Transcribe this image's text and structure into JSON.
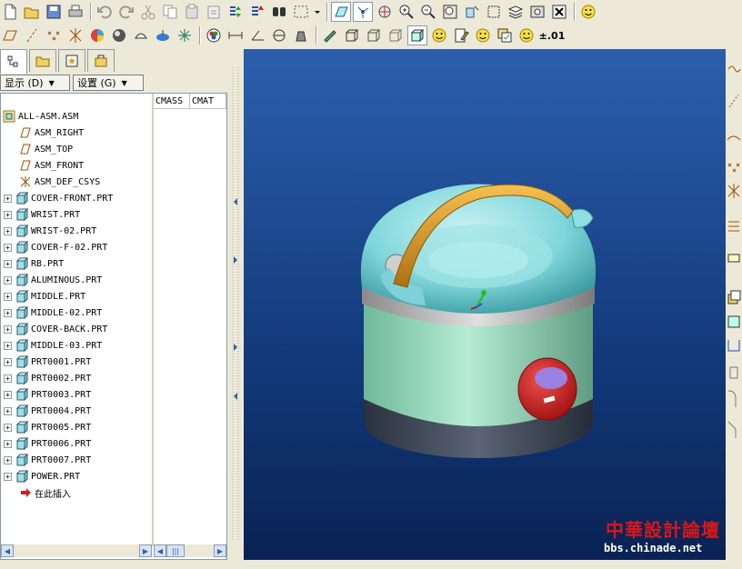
{
  "toolbar_top": {
    "icons": [
      "new-icon",
      "open-icon",
      "save-icon",
      "print-icon",
      "undo-icon",
      "redo-icon",
      "cut-icon",
      "copy-icon",
      "paste-icon",
      "paste-special-icon",
      "regenerate-icon",
      "regenerate-manager-icon",
      "find-icon",
      "select-box-icon",
      "dropdown-icon",
      "datum-display-icon",
      "datum-point-display-icon",
      "spin-center-icon",
      "zoom-in-icon",
      "zoom-out-icon",
      "refit-icon",
      "reorient-icon",
      "view-manager-icon",
      "layers-icon",
      "saved-views-icon",
      "close-window-icon",
      "smiley-icon"
    ]
  },
  "toolbar_second": {
    "precision_label": "±.01"
  },
  "tabs": [
    "model-tree-tab",
    "folder-browser-tab",
    "favorites-tab",
    "connections-tab"
  ],
  "dropdowns": {
    "show": "显示 (D)",
    "settings": "设置 (G)"
  },
  "columns": [
    "CMASS",
    "CMAT"
  ],
  "tree": [
    {
      "label": "ALL-ASM.ASM",
      "type": "assembly",
      "expand": false,
      "indent": 0
    },
    {
      "label": "ASM_RIGHT",
      "type": "plane",
      "expand": false,
      "indent": 1
    },
    {
      "label": "ASM_TOP",
      "type": "plane",
      "expand": false,
      "indent": 1
    },
    {
      "label": "ASM_FRONT",
      "type": "plane",
      "expand": false,
      "indent": 1
    },
    {
      "label": "ASM_DEF_CSYS",
      "type": "csys",
      "expand": false,
      "indent": 1
    },
    {
      "label": "COVER-FRONT.PRT",
      "type": "part",
      "expand": true,
      "indent": 0
    },
    {
      "label": "WRIST.PRT",
      "type": "part",
      "expand": true,
      "indent": 0
    },
    {
      "label": "WRIST-02.PRT",
      "type": "part",
      "expand": true,
      "indent": 0
    },
    {
      "label": "COVER-F-02.PRT",
      "type": "part",
      "expand": true,
      "indent": 0
    },
    {
      "label": "RB.PRT",
      "type": "part",
      "expand": true,
      "indent": 0
    },
    {
      "label": "ALUMINOUS.PRT",
      "type": "part",
      "expand": true,
      "indent": 0
    },
    {
      "label": "MIDDLE.PRT",
      "type": "part",
      "expand": true,
      "indent": 0
    },
    {
      "label": "MIDDLE-02.PRT",
      "type": "part",
      "expand": true,
      "indent": 0
    },
    {
      "label": "COVER-BACK.PRT",
      "type": "part",
      "expand": true,
      "indent": 0
    },
    {
      "label": "MIDDLE-03.PRT",
      "type": "part",
      "expand": true,
      "indent": 0
    },
    {
      "label": "PRT0001.PRT",
      "type": "part",
      "expand": true,
      "indent": 0
    },
    {
      "label": "PRT0002.PRT",
      "type": "part",
      "expand": true,
      "indent": 0
    },
    {
      "label": "PRT0003.PRT",
      "type": "part",
      "expand": true,
      "indent": 0
    },
    {
      "label": "PRT0004.PRT",
      "type": "part",
      "expand": true,
      "indent": 0
    },
    {
      "label": "PRT0005.PRT",
      "type": "part",
      "expand": true,
      "indent": 0
    },
    {
      "label": "PRT0006.PRT",
      "type": "part",
      "expand": true,
      "indent": 0
    },
    {
      "label": "PRT0007.PRT",
      "type": "part",
      "expand": true,
      "indent": 0
    },
    {
      "label": "POWER.PRT",
      "type": "part",
      "expand": true,
      "indent": 0
    },
    {
      "label": "在此插入",
      "type": "insert",
      "expand": false,
      "indent": 1
    }
  ],
  "watermark": {
    "title": "中華設計論壇",
    "url": "bbs.chinade.net"
  },
  "colors": {
    "viewport_top": "#2c5fae",
    "viewport_bottom": "#0a2254",
    "cooker_lid": "#7fd6da",
    "cooker_body": "#9fe0c0",
    "handle": "#e8a020",
    "button_red": "#d82020",
    "watermark_red": "#d81818"
  }
}
